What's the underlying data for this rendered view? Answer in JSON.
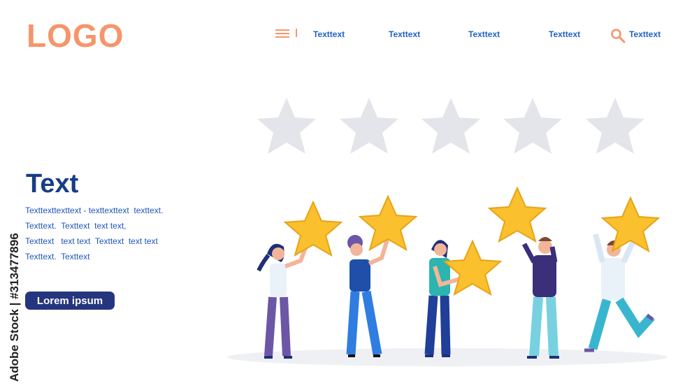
{
  "header": {
    "logo": "LOGO",
    "nav_items": [
      "Texttext",
      "Texttext",
      "Texttext",
      "Texttext",
      "Texttext"
    ],
    "menu_icon": "hamburger-menu-icon",
    "search_icon": "search-icon"
  },
  "hero": {
    "title": "Text",
    "paragraph": [
      "Texttexttexttext - texttexttext  texttext.",
      "Texttext.  Texttext  text text,",
      "Texttext   text text  Texttext  text text",
      "Texttext.  Texttext"
    ],
    "button_label": "Lorem ipsum"
  },
  "rating": {
    "empty_stars": 5
  },
  "illustration": {
    "people": 5,
    "held_stars": 5
  },
  "watermark": "Adobe Stock | #313477896",
  "colors": {
    "logo": "#f6956b",
    "nav": "#1f62c6",
    "title": "#183d86",
    "button": "#25357e",
    "star_empty": "#e4e5ea",
    "star_gold": "#fbc02d"
  }
}
